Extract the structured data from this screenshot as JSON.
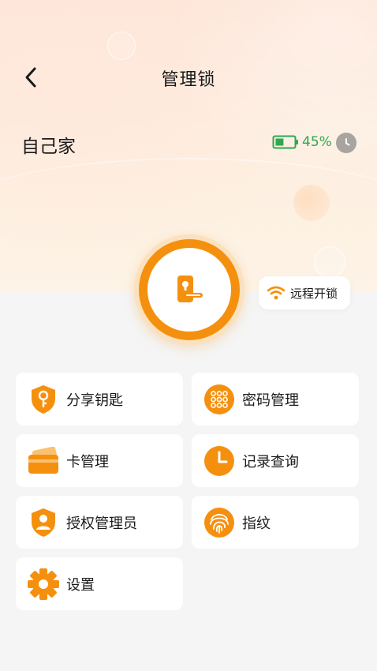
{
  "header": {
    "title": "管理锁"
  },
  "home": {
    "name": "自己家",
    "battery_percent": 45,
    "battery_text": "45%"
  },
  "colors": {
    "accent": "#f5900f",
    "battery": "#2fa84f"
  },
  "remote": {
    "label": "远程开锁",
    "icon": "wifi-icon"
  },
  "menu": [
    {
      "label": "分享钥匙",
      "icon": "key-shield-icon"
    },
    {
      "label": "密码管理",
      "icon": "keypad-icon"
    },
    {
      "label": "卡管理",
      "icon": "card-icon"
    },
    {
      "label": "记录查询",
      "icon": "clock-icon"
    },
    {
      "label": "授权管理员",
      "icon": "admin-shield-icon"
    },
    {
      "label": "指纹",
      "icon": "fingerprint-icon"
    },
    {
      "label": "设置",
      "icon": "gear-icon"
    }
  ]
}
